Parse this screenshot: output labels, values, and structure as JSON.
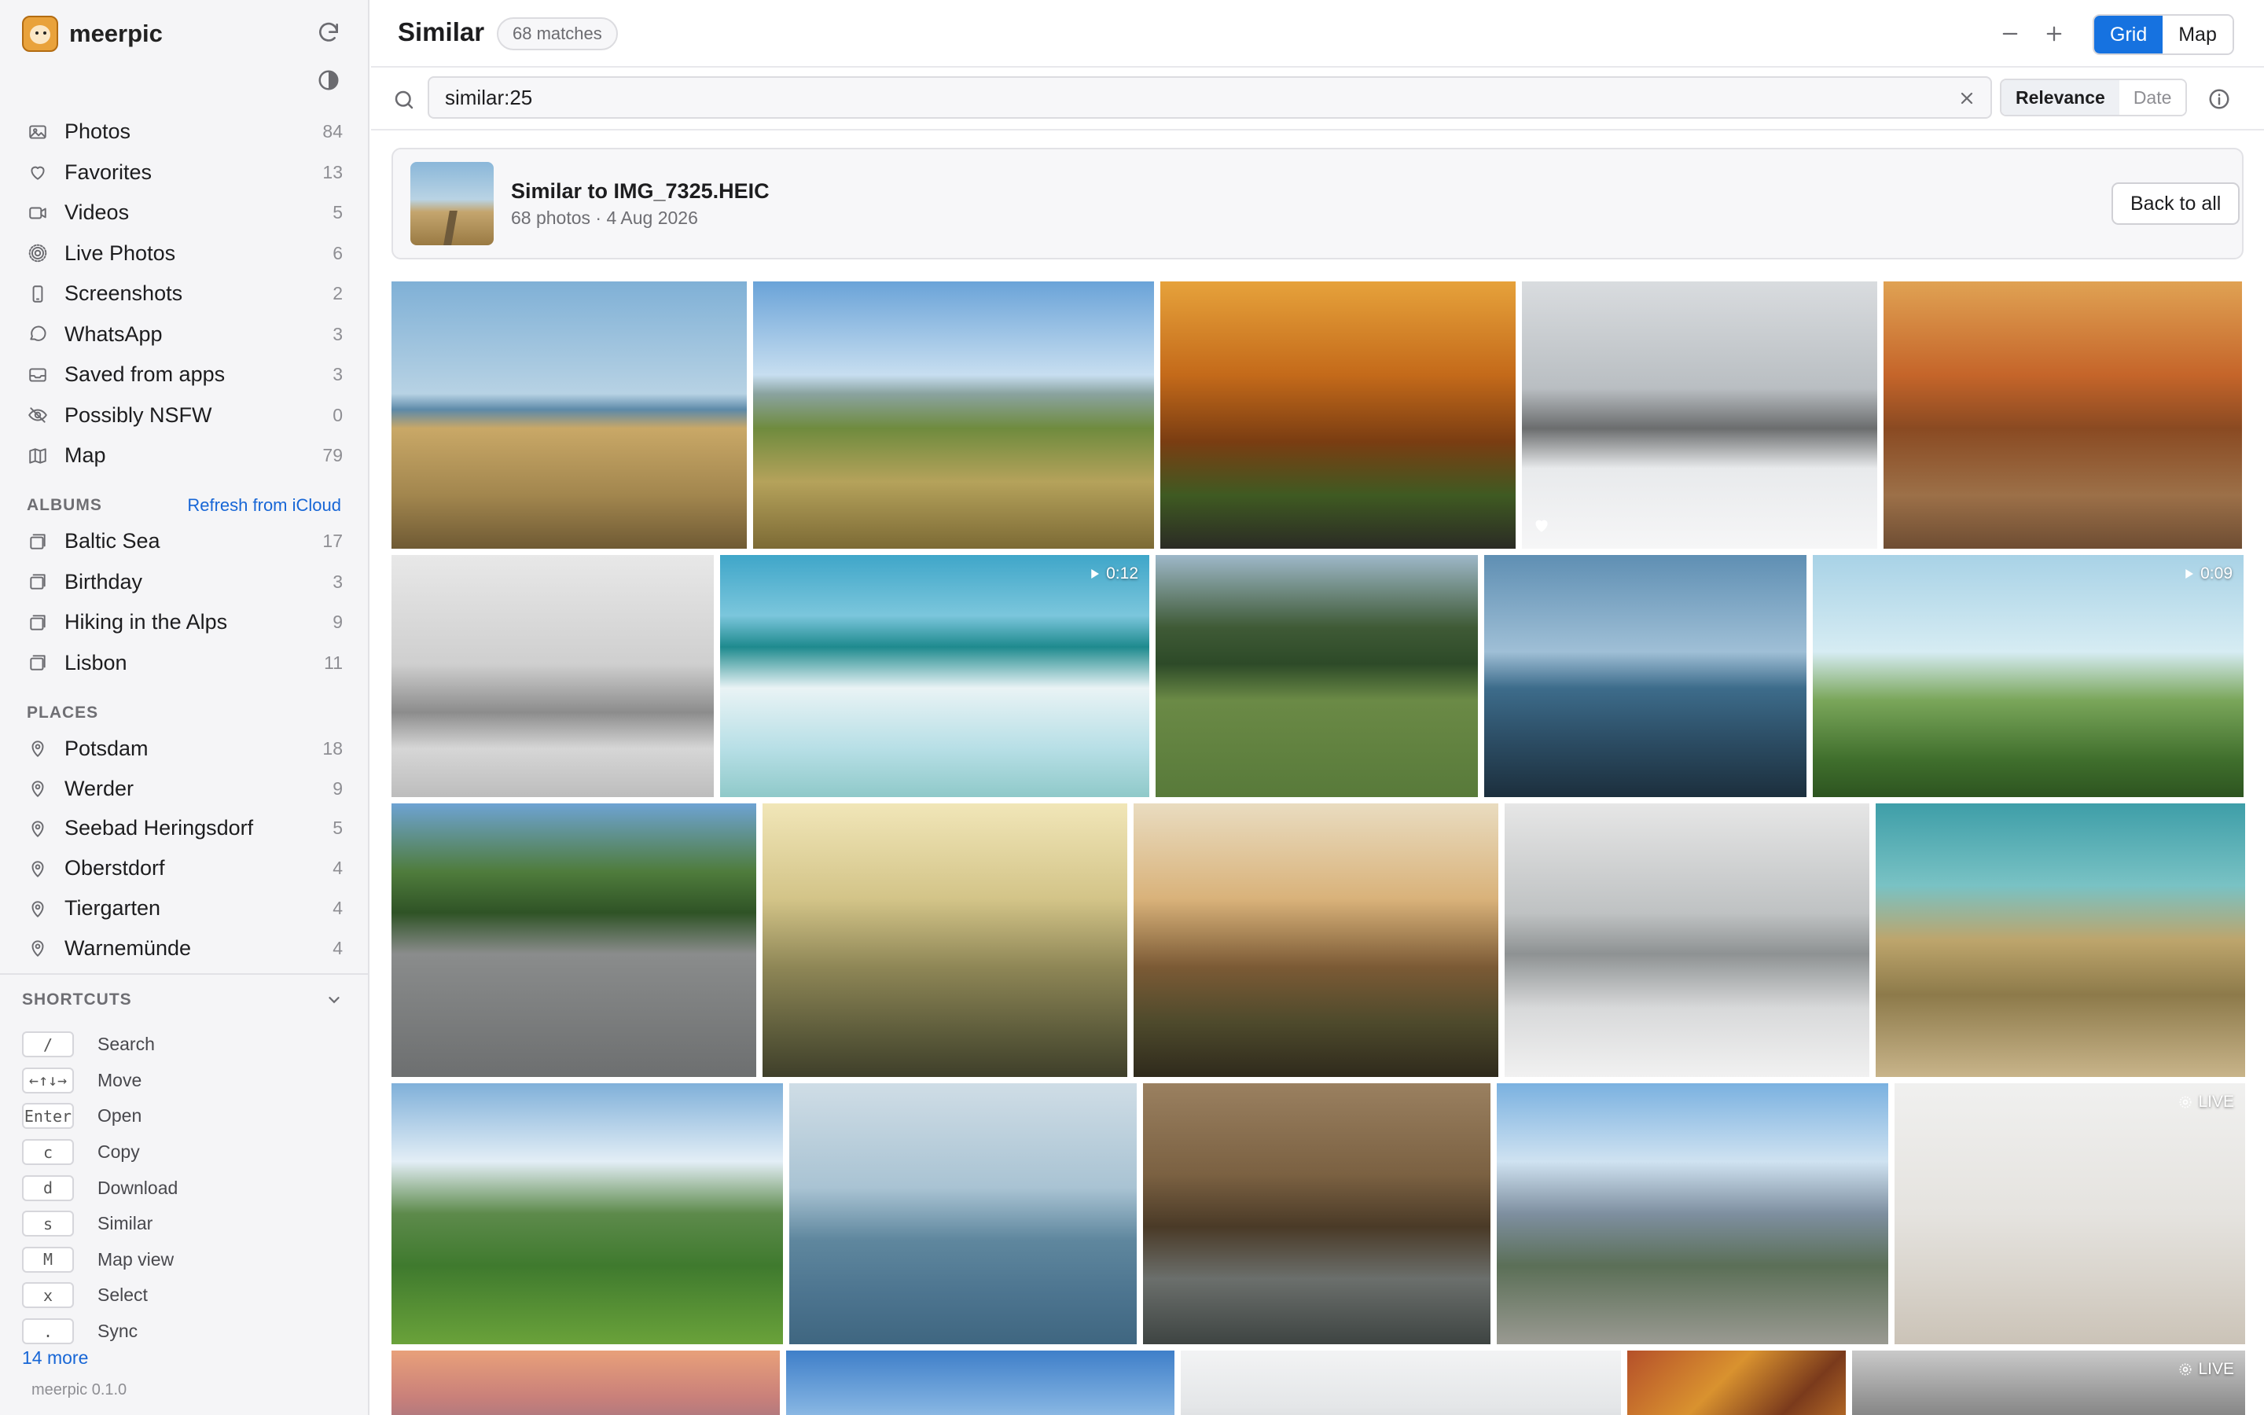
{
  "app": {
    "name": "meerpic",
    "version": "meerpic 0.1.0"
  },
  "sidebar": {
    "library": [
      {
        "label": "Photos",
        "count": "84",
        "icon": "photo-icon"
      },
      {
        "label": "Favorites",
        "count": "13",
        "icon": "heart-icon"
      },
      {
        "label": "Videos",
        "count": "5",
        "icon": "video-icon"
      },
      {
        "label": "Live Photos",
        "count": "6",
        "icon": "live-icon"
      },
      {
        "label": "Screenshots",
        "count": "2",
        "icon": "phone-icon"
      },
      {
        "label": "WhatsApp",
        "count": "3",
        "icon": "chat-icon"
      },
      {
        "label": "Saved from apps",
        "count": "3",
        "icon": "inbox-icon"
      },
      {
        "label": "Possibly NSFW",
        "count": "0",
        "icon": "eye-off-icon"
      },
      {
        "label": "Map",
        "count": "79",
        "icon": "map-icon"
      }
    ],
    "albums_heading": "ALBUMS",
    "albums_refresh": "Refresh from iCloud",
    "albums": [
      {
        "label": "Baltic Sea",
        "count": "17"
      },
      {
        "label": "Birthday",
        "count": "3"
      },
      {
        "label": "Hiking in the Alps",
        "count": "9"
      },
      {
        "label": "Lisbon",
        "count": "11"
      }
    ],
    "places_heading": "PLACES",
    "places": [
      {
        "label": "Potsdam",
        "count": "18"
      },
      {
        "label": "Werder",
        "count": "9"
      },
      {
        "label": "Seebad Heringsdorf",
        "count": "5"
      },
      {
        "label": "Oberstdorf",
        "count": "4"
      },
      {
        "label": "Tiergarten",
        "count": "4"
      },
      {
        "label": "Warnemünde",
        "count": "4"
      }
    ],
    "shortcuts_heading": "SHORTCUTS",
    "shortcuts": [
      {
        "key": "/",
        "label": "Search"
      },
      {
        "key": "←↑↓→",
        "label": "Move"
      },
      {
        "key": "Enter",
        "label": "Open"
      },
      {
        "key": "c",
        "label": "Copy"
      },
      {
        "key": "d",
        "label": "Download"
      },
      {
        "key": "s",
        "label": "Similar"
      },
      {
        "key": "M",
        "label": "Map view"
      },
      {
        "key": "x",
        "label": "Select"
      },
      {
        "key": ".",
        "label": "Sync"
      }
    ],
    "more_shortcuts": "14 more"
  },
  "header": {
    "title": "Similar",
    "matches": "68 matches",
    "view_grid": "Grid",
    "view_map": "Map",
    "active_view": "Grid"
  },
  "search": {
    "value": "similar:25",
    "sort_relevance": "Relevance",
    "sort_date": "Date",
    "active_sort": "Relevance"
  },
  "similar_card": {
    "title": "Similar to IMG_7325.HEIC",
    "subtitle": "68 photos · 4 Aug 2026",
    "back_label": "Back to all"
  },
  "photos": [
    [
      {
        "scene": "beach-path-dunes",
        "favorite": false,
        "badge": ""
      },
      {
        "scene": "hikers-hill-path",
        "favorite": false,
        "badge": ""
      },
      {
        "scene": "autumn-forest-road",
        "favorite": false,
        "badge": ""
      },
      {
        "scene": "snowy-tree-lane",
        "favorite": true,
        "badge": ""
      },
      {
        "scene": "autumn-birch-path",
        "favorite": false,
        "badge": ""
      }
    ],
    [
      {
        "scene": "frosted-trees",
        "favorite": false,
        "badge": ""
      },
      {
        "scene": "crashing-wave",
        "favorite": false,
        "badge": "0:12",
        "badge_type": "video"
      },
      {
        "scene": "sheep-meadow",
        "favorite": false,
        "badge": ""
      },
      {
        "scene": "person-at-sea",
        "favorite": false,
        "badge": ""
      },
      {
        "scene": "cow-in-grass",
        "favorite": false,
        "badge": "0:09",
        "badge_type": "video"
      }
    ],
    [
      {
        "scene": "bike-lane",
        "favorite": false,
        "badge": ""
      },
      {
        "scene": "cow-in-mist",
        "favorite": false,
        "badge": ""
      },
      {
        "scene": "horses-sunset",
        "favorite": false,
        "badge": ""
      },
      {
        "scene": "snowy-railway",
        "favorite": false,
        "badge": ""
      },
      {
        "scene": "bikes-on-dune",
        "favorite": false,
        "badge": ""
      }
    ],
    [
      {
        "scene": "green-valley",
        "favorite": false,
        "badge": ""
      },
      {
        "scene": "lighthouse-sea",
        "favorite": false,
        "badge": ""
      },
      {
        "scene": "swan-reeds",
        "favorite": false,
        "badge": ""
      },
      {
        "scene": "hiker-mountains",
        "favorite": false,
        "badge": ""
      },
      {
        "scene": "shell-on-shore",
        "favorite": false,
        "badge": "LIVE",
        "badge_type": "live"
      }
    ],
    [
      {
        "scene": "sunset-clouds",
        "favorite": false,
        "badge": ""
      },
      {
        "scene": "blue-sky",
        "favorite": false,
        "badge": ""
      },
      {
        "scene": "pale-sky",
        "favorite": false,
        "badge": ""
      },
      {
        "scene": "autumn-leaves",
        "favorite": false,
        "badge": ""
      },
      {
        "scene": "blurred-grey",
        "favorite": false,
        "badge": "LIVE",
        "badge_type": "live"
      }
    ]
  ],
  "colors": {
    "accent": "#1672e0",
    "link": "#1766d6",
    "sidebar_bg": "#f5f5f7",
    "muted": "#8e8e93"
  }
}
